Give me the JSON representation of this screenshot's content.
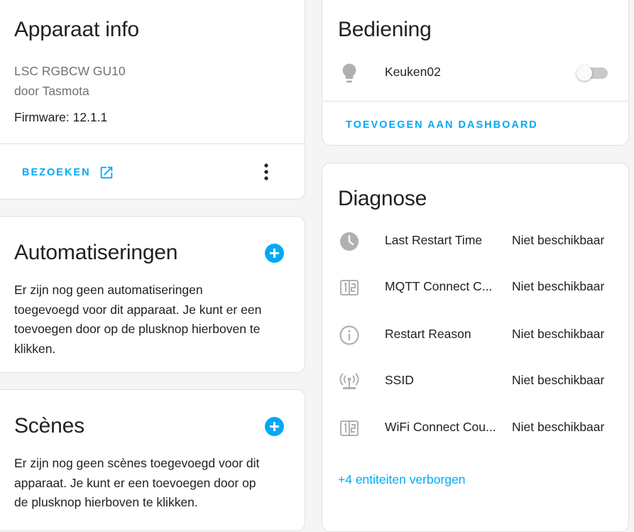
{
  "device_info": {
    "title": "Apparaat info",
    "model": "LSC RGBCW GU10",
    "manufacturer": "door Tasmota",
    "firmware": "Firmware: 12.1.1",
    "visit_label": "BEZOEKEN",
    "external_link_icon": "open-in-new-icon",
    "more_icon": "dots-vertical-icon"
  },
  "automations": {
    "title": "Automatiseringen",
    "text_lines": [
      "Er zijn nog geen automatiseringen",
      "toegevoegd voor dit apparaat. Je kunt er een",
      "toevoegen door op de plusknop hierboven te",
      "klikken."
    ],
    "add_icon": "plus-circle-icon"
  },
  "scenes": {
    "title": "Scènes",
    "text_lines": [
      "Er zijn nog geen scènes toegevoegd voor dit",
      "apparaat. Je kunt er een toevoegen door op",
      "de plusknop hierboven te klikken."
    ],
    "add_icon": "plus-circle-icon"
  },
  "controls": {
    "title": "Bediening",
    "entity": {
      "name": "Keuken02",
      "icon": "lightbulb-icon",
      "state": "off"
    },
    "add_to_dashboard_label": "TOEVOEGEN AAN DASHBOARD"
  },
  "diagnostics": {
    "title": "Diagnose",
    "entities": [
      {
        "name": "Last Restart Time",
        "state": "Niet beschikbaar",
        "icon": "clock-icon"
      },
      {
        "name": "MQTT Connect C...",
        "state": "Niet beschikbaar",
        "icon": "counter-icon"
      },
      {
        "name": "Restart Reason",
        "state": "Niet beschikbaar",
        "icon": "information-outline-icon"
      },
      {
        "name": "SSID",
        "state": "Niet beschikbaar",
        "icon": "access-point-network-icon"
      },
      {
        "name": "WiFi Connect Cou...",
        "state": "Niet beschikbaar",
        "icon": "counter-icon"
      }
    ],
    "hidden_entities_label": "+4 entiteiten verborgen"
  },
  "colors": {
    "accent": "#03a9f4",
    "icon_gray": "#b0b0b0",
    "background": "#f5f5f5",
    "card": "#ffffff",
    "divider": "#e0e0e0"
  }
}
